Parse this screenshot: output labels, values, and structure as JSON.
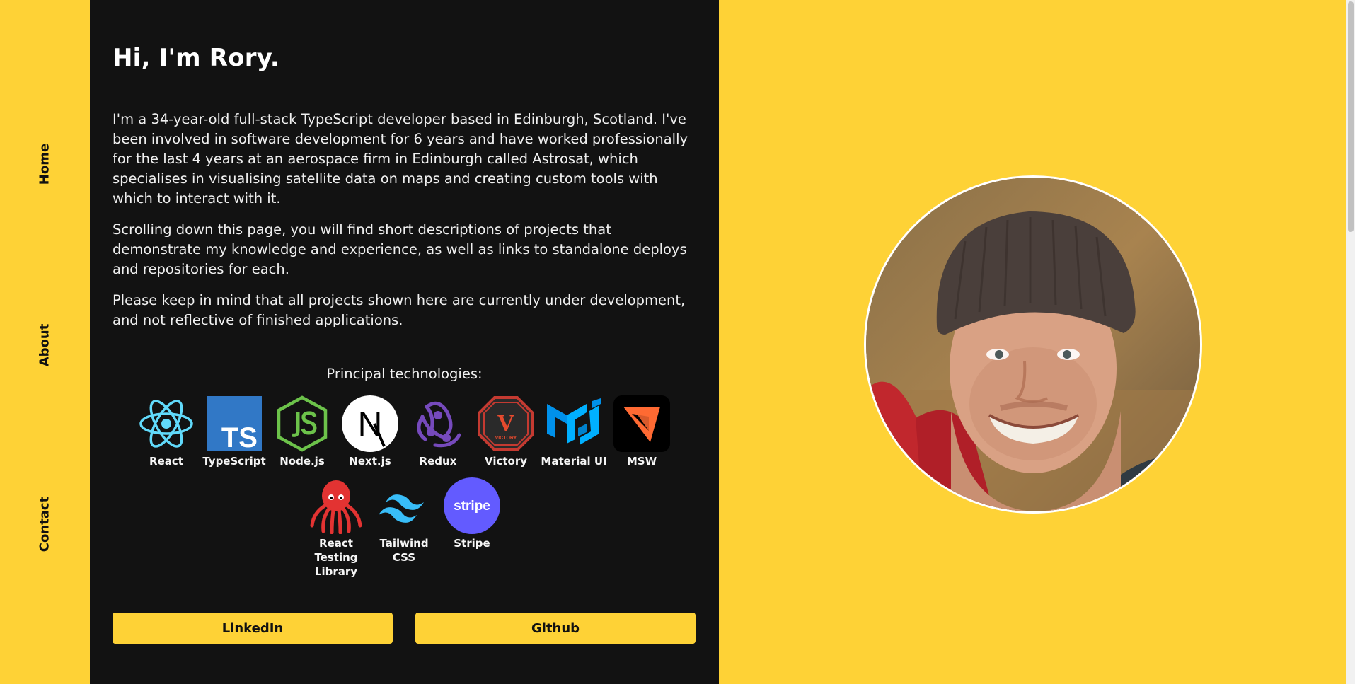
{
  "nav": {
    "home": "Home",
    "about": "About",
    "contact": "Contact"
  },
  "intro": {
    "heading": "Hi, I'm Rory.",
    "paragraphs": [
      "I'm a 34-year-old full-stack TypeScript developer based in Edinburgh, Scotland. I've been involved in software development for 6 years and have worked professionally for the last 4 years at an aerospace firm in Edinburgh called Astrosat, which specialises in visualising satellite data on maps and creating custom tools with which to interact with it.",
      "Scrolling down this page, you will find short descriptions of projects that demonstrate my knowledge and experience, as well as links to standalone deploys and repositories for each.",
      "Please keep in mind that all projects shown here are currently under development, and not reflective of finished applications."
    ]
  },
  "technologies": {
    "title": "Principal technologies:",
    "items": [
      {
        "label": "React",
        "icon": "react-icon"
      },
      {
        "label": "TypeScript",
        "icon": "typescript-icon"
      },
      {
        "label": "Node.js",
        "icon": "nodejs-icon"
      },
      {
        "label": "Next.js",
        "icon": "nextjs-icon"
      },
      {
        "label": "Redux",
        "icon": "redux-icon"
      },
      {
        "label": "Victory",
        "icon": "victory-icon"
      },
      {
        "label": "Material UI",
        "icon": "material-ui-icon"
      },
      {
        "label": "MSW",
        "icon": "msw-icon"
      },
      {
        "label": "React Testing Library",
        "icon": "react-testing-library-icon"
      },
      {
        "label": "Tailwind CSS",
        "icon": "tailwind-css-icon"
      },
      {
        "label": "Stripe",
        "icon": "stripe-icon"
      }
    ],
    "logo_text": {
      "typescript": "TS",
      "nextjs": "N",
      "victory": "V",
      "victory_sub": "VICTORY",
      "stripe": "stripe"
    }
  },
  "links": {
    "linkedin": "LinkedIn",
    "github": "Github"
  },
  "colors": {
    "accent": "#fed236",
    "panel": "#121212"
  }
}
